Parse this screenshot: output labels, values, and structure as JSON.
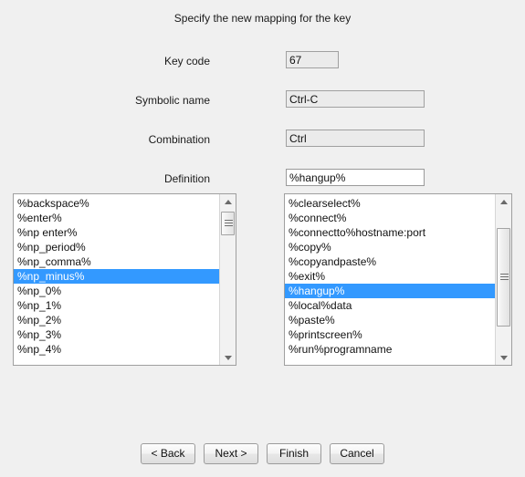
{
  "dialog": {
    "title": "Specify the new mapping for the key"
  },
  "form": {
    "fields": [
      {
        "label": "Key code",
        "value": "67",
        "editable": false,
        "width": "narrow"
      },
      {
        "label": "Symbolic name",
        "value": "Ctrl-C",
        "editable": false,
        "width": "wide"
      },
      {
        "label": "Combination",
        "value": "Ctrl",
        "editable": false,
        "width": "wide"
      },
      {
        "label": "Definition",
        "value": "%hangup%",
        "editable": true,
        "width": "wide"
      }
    ]
  },
  "list_left": {
    "items": [
      "%backspace%",
      "%enter%",
      "%np enter%",
      "%np_period%",
      "%np_comma%",
      "%np_minus%",
      "%np_0%",
      "%np_1%",
      "%np_2%",
      "%np_3%",
      "%np_4%"
    ],
    "selected_index": 5,
    "scrollbar": {
      "up_icon": "triangle-up-icon",
      "down_icon": "triangle-down-icon",
      "thumb_grip_icon": "grip-lines-icon"
    }
  },
  "list_right": {
    "items": [
      "%clearselect%",
      "%connect%",
      "%connectto%hostname:port",
      "%copy%",
      "%copyandpaste%",
      "%exit%",
      "%hangup%",
      "%local%data",
      "%paste%",
      "%printscreen%",
      "%run%programname"
    ],
    "selected_index": 6,
    "scrollbar": {
      "up_icon": "triangle-up-icon",
      "down_icon": "triangle-down-icon",
      "thumb_grip_icon": "grip-lines-icon"
    }
  },
  "buttons": [
    {
      "label": "< Back",
      "name": "back-button"
    },
    {
      "label": "Next >",
      "name": "next-button"
    },
    {
      "label": "Finish",
      "name": "finish-button"
    },
    {
      "label": "Cancel",
      "name": "cancel-button"
    }
  ],
  "colors": {
    "background": "#f0f0f0",
    "selection": "#3399ff",
    "selection_text": "#ffffff",
    "field_readonly_bg": "#ebebeb",
    "field_editable_bg": "#ffffff",
    "list_bg": "#ffffff",
    "border": "#9f9f9f"
  }
}
